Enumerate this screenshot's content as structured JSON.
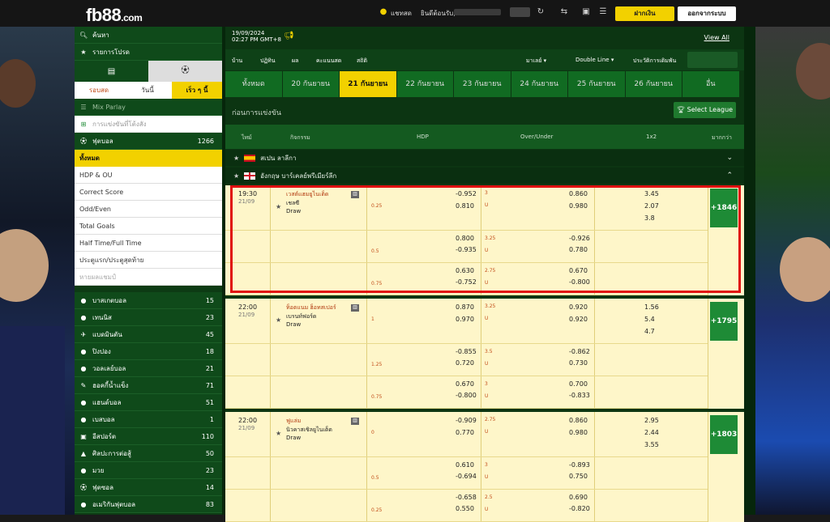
{
  "topbar": {
    "logo_main": "fb88",
    "logo_suffix": ".com",
    "chat": "แชทสด",
    "welcome": "ยินดีต้อนรับ,",
    "deposit": "ฝากเงิน",
    "logout": "ออกจากระบบ"
  },
  "header": {
    "date": "19/09/2024",
    "time": "02:27 PM GMT+8",
    "view_all": "View All"
  },
  "nav": {
    "items": [
      "บ้าน",
      "ปฏิทิน",
      "ผล",
      "คะแนนสด",
      "สถิติ"
    ],
    "market": "มาเลย์",
    "odds": "Double Line",
    "history": "ประวัติการเดิมพัน"
  },
  "date_tabs": [
    "ทั้งหมด",
    "20 กันยายน",
    "21 กันยายน",
    "22 กันยายน",
    "23 กันยายน",
    "24 กันยายน",
    "25 กันยายน",
    "26 กันยายน",
    "อื่น"
  ],
  "section": {
    "title": "ก่อนการแข่งขัน",
    "select_league": "Select League"
  },
  "table_head": {
    "time": "ไทม์",
    "event": "กิจกรรม",
    "hdp": "HDP",
    "ou": "Over/Under",
    "x12": "1x2",
    "more": "มากกว่า"
  },
  "leagues": [
    {
      "name": "สเปน ลาลีกา"
    },
    {
      "name": "อังกฤษ พรีเมียร์ลีก",
      "name_full": "อังกฤษ บาร์เคลย์พรีเมียร์ลีก"
    }
  ],
  "matches": [
    {
      "time": "19:30",
      "date": "21/09",
      "home": "เวสต์แฮมยูไนเต็ด",
      "away": "เชลซี",
      "draw": "Draw",
      "more": "+1846",
      "rows": [
        {
          "hdp": "0.25",
          "h1": "-0.952",
          "h2": "0.810",
          "ou": "3",
          "o1": "0.860",
          "u": "U",
          "o2": "0.980",
          "x1": "3.45",
          "x2": "2.07",
          "x3": "3.8"
        },
        {
          "hdp": "0.5",
          "h1": "0.800",
          "h2": "-0.935",
          "ou": "3.25",
          "o1": "-0.926",
          "u": "U",
          "o2": "0.780"
        },
        {
          "hdp": "0.75",
          "h1": "0.630",
          "h2": "-0.752",
          "ou": "2.75",
          "o1": "0.670",
          "u": "U",
          "o2": "-0.800"
        }
      ]
    },
    {
      "time": "22:00",
      "date": "21/09",
      "home": "ท็อตแนม ฮ็อทสเปอร์",
      "away": "เบรนท์ฟอร์ด",
      "draw": "Draw",
      "more": "+1795",
      "rows": [
        {
          "hdp": "1",
          "h1": "0.870",
          "h2": "0.970",
          "ou": "3.25",
          "o1": "0.920",
          "u": "U",
          "o2": "0.920",
          "x1": "1.56",
          "x2": "5.4",
          "x3": "4.7"
        },
        {
          "hdp": "1.25",
          "h1": "-0.855",
          "h2": "0.720",
          "ou": "3.5",
          "o1": "-0.862",
          "u": "U",
          "o2": "0.730"
        },
        {
          "hdp": "0.75",
          "h1": "0.670",
          "h2": "-0.800",
          "ou": "3",
          "o1": "0.700",
          "u": "U",
          "o2": "-0.833"
        }
      ]
    },
    {
      "time": "22:00",
      "date": "21/09",
      "home": "ฟูแล่ม",
      "away": "นิวคาสเซิลยูไนเต็ด",
      "draw": "Draw",
      "more": "+1803",
      "rows": [
        {
          "hdp": "0",
          "h1": "-0.909",
          "h2": "0.770",
          "ou": "2.75",
          "o1": "0.860",
          "u": "U",
          "o2": "0.980",
          "x1": "2.95",
          "x2": "2.44",
          "x3": "3.55"
        },
        {
          "hdp": "0.5",
          "h1": "0.610",
          "h2": "-0.694",
          "ou": "3",
          "o1": "-0.893",
          "u": "U",
          "o2": "0.750"
        },
        {
          "hdp": "0.25",
          "h1": "-0.658",
          "h2": "0.550",
          "ou": "2.5",
          "o1": "0.690",
          "u": "U",
          "o2": "-0.820"
        }
      ]
    }
  ],
  "sidebar": {
    "search": "ค้นหา",
    "favorites": "รายการโปรด",
    "tabs": [
      "รอบสด",
      "วันนี้",
      "เร็ว ๆ นี้"
    ],
    "mix_parlay": "Mix Parlay",
    "parlay_hint": "การแข่งขันที่โต้งสัง",
    "football": "ฟุตบอล",
    "football_count": "1266",
    "all": "ทั้งหมด",
    "markets": [
      "HDP & OU",
      "Correct Score",
      "Odd/Even",
      "Total Goals",
      "Half Time/Full Time",
      "ประตูแรก/ประตูสุดท้าย",
      "หายผลแชมป์"
    ],
    "sports": [
      {
        "name": "บาสเกตบอล",
        "count": "15"
      },
      {
        "name": "เทนนิส",
        "count": "23"
      },
      {
        "name": "แบดมินตัน",
        "count": "45"
      },
      {
        "name": "ปิงปอง",
        "count": "18"
      },
      {
        "name": "วอลเลย์บอล",
        "count": "21"
      },
      {
        "name": "ฮอคกี้น้ำแข็ง",
        "count": "71"
      },
      {
        "name": "แฮนด์บอล",
        "count": "51"
      },
      {
        "name": "เบสบอล",
        "count": "1"
      },
      {
        "name": "อีสปอร์ต",
        "count": "110"
      },
      {
        "name": "ศิลปะการต่อสู้",
        "count": "50"
      },
      {
        "name": "มวย",
        "count": "23"
      },
      {
        "name": "ฟุตซอล",
        "count": "14"
      },
      {
        "name": "อเมริกันฟุตบอล",
        "count": "83"
      }
    ]
  }
}
